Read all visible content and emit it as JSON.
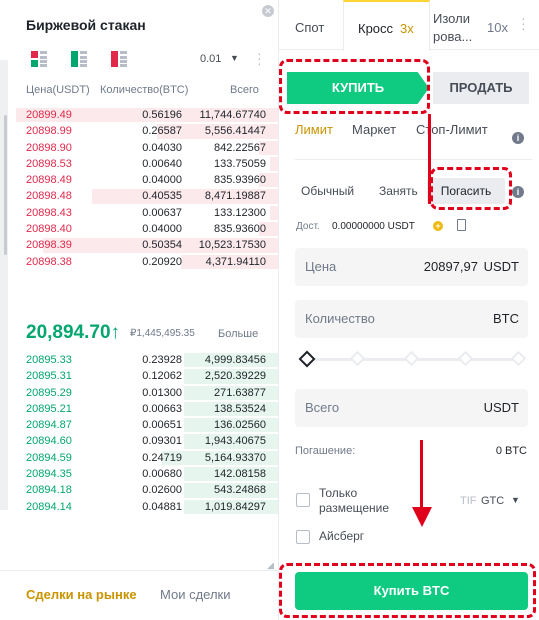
{
  "order_book": {
    "title": "Биржевой стакан",
    "precision": "0.01",
    "headers": {
      "price": "Цена(USDT)",
      "qty": "Количество(BTC)",
      "total": "Всего"
    },
    "asks": [
      {
        "price": "20899.49",
        "qty": "0.56196",
        "total": "11,744.67740",
        "depth": 0.97
      },
      {
        "price": "20898.99",
        "qty": "0.26587",
        "total": "5,556.41447",
        "depth": 0.45
      },
      {
        "price": "20898.90",
        "qty": "0.04030",
        "total": "842.22567",
        "depth": 0.07
      },
      {
        "price": "20898.53",
        "qty": "0.00640",
        "total": "133.75059",
        "depth": 0.03
      },
      {
        "price": "20898.49",
        "qty": "0.04000",
        "total": "835.93960",
        "depth": 0.07
      },
      {
        "price": "20898.48",
        "qty": "0.40535",
        "total": "8,471.19887",
        "depth": 0.69
      },
      {
        "price": "20898.43",
        "qty": "0.00637",
        "total": "133.12300",
        "depth": 0.03
      },
      {
        "price": "20898.40",
        "qty": "0.04000",
        "total": "835.93600",
        "depth": 0.07
      },
      {
        "price": "20898.39",
        "qty": "0.50354",
        "total": "10,523.17530",
        "depth": 0.87
      },
      {
        "price": "20898.38",
        "qty": "0.20920",
        "total": "4,371.94110",
        "depth": 0.36
      }
    ],
    "last_price": "20,894.70↑",
    "last_price_fiat": "₽1,445,495.35",
    "more": "Больше",
    "bids": [
      {
        "price": "20895.33",
        "qty": "0.23928",
        "total": "4,999.83456",
        "depth": 0.35
      },
      {
        "price": "20895.31",
        "qty": "0.12062",
        "total": "2,520.39229",
        "depth": 0.35
      },
      {
        "price": "20895.29",
        "qty": "0.01300",
        "total": "271.63877",
        "depth": 0.35
      },
      {
        "price": "20895.21",
        "qty": "0.00663",
        "total": "138.53524",
        "depth": 0.35
      },
      {
        "price": "20894.87",
        "qty": "0.00651",
        "total": "136.02560",
        "depth": 0.35
      },
      {
        "price": "20894.60",
        "qty": "0.09301",
        "total": "1,943.40675",
        "depth": 0.35
      },
      {
        "price": "20894.59",
        "qty": "0.24719",
        "total": "5,164.93370",
        "depth": 0.43
      },
      {
        "price": "20894.35",
        "qty": "0.00680",
        "total": "142.08158",
        "depth": 0.35
      },
      {
        "price": "20894.18",
        "qty": "0.02600",
        "total": "543.24868",
        "depth": 0.35
      },
      {
        "price": "20894.14",
        "qty": "0.04881",
        "total": "1,019.84297",
        "depth": 0.35
      }
    ],
    "bottom_tabs": {
      "market_trades": "Сделки на рынке",
      "my_trades": "Мои сделки"
    }
  },
  "order_form": {
    "tabs": {
      "spot": "Спот",
      "cross": "Кросс",
      "cross_leverage": "3x",
      "isolated": "Изоли рова...",
      "isolated_leverage": "10x"
    },
    "buy": "КУПИТЬ",
    "sell": "ПРОДАТЬ",
    "order_types": {
      "limit": "Лимит",
      "market": "Маркет",
      "stop_limit": "Стоп-Лимит"
    },
    "modes": {
      "normal": "Обычный",
      "borrow": "Занять",
      "repay": "Погасить"
    },
    "available_label": "Дост.",
    "available_value": "0.00000000 USDT",
    "price": {
      "label": "Цена",
      "value": "20897,97",
      "unit": "USDT"
    },
    "quantity": {
      "label": "Количество",
      "unit": "BTC"
    },
    "total": {
      "label": "Всего",
      "unit": "USDT"
    },
    "repay_label": "Погашение:",
    "repay_value": "0 BTC",
    "only_repay": "Только размещение",
    "iceberg": "Айсберг",
    "tif": "TIF",
    "gtc": "GTC",
    "submit": "Купить BTC"
  },
  "colors": {
    "buy": "#0ecb81",
    "sell_text": "#e0294a",
    "accent": "#c99400",
    "highlight": "#e0001b"
  }
}
